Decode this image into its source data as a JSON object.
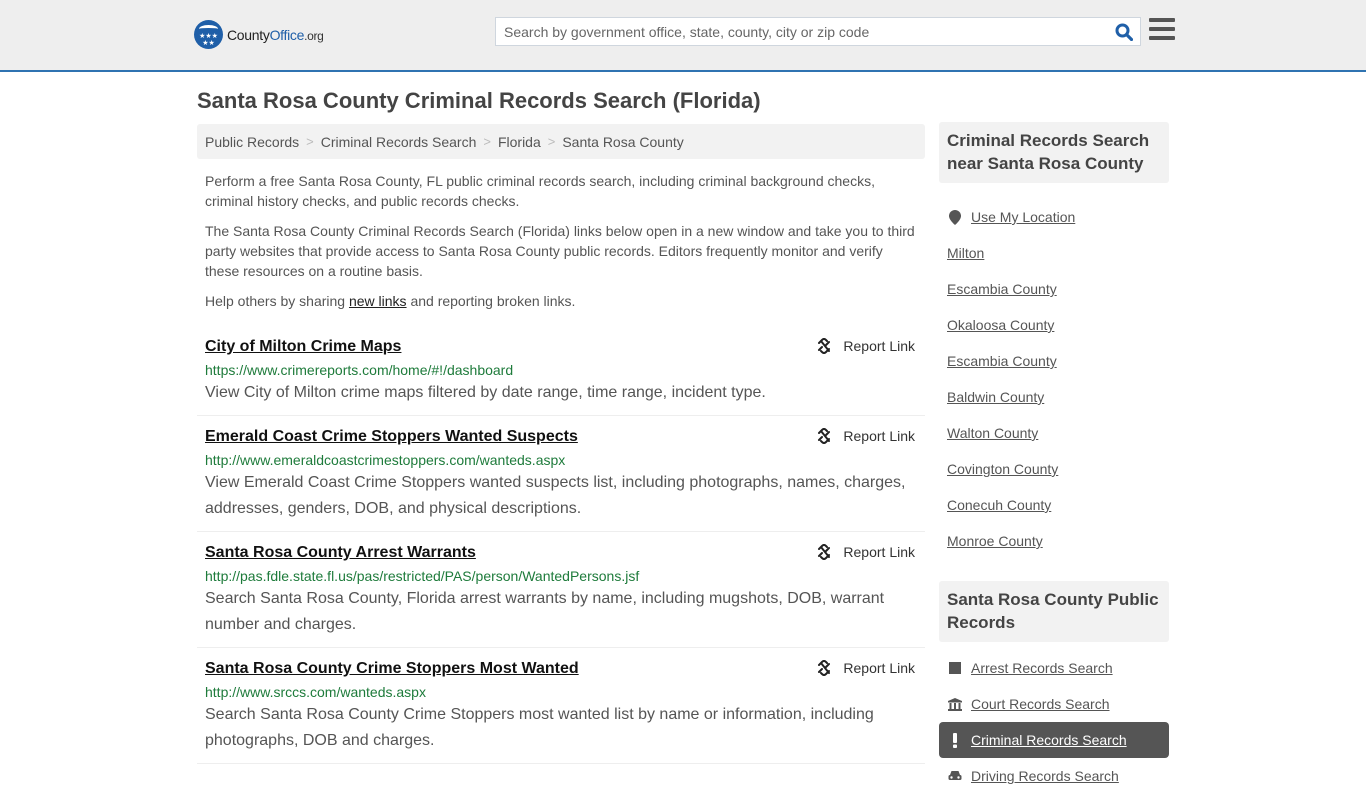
{
  "header": {
    "logo": {
      "brand_part1": "County",
      "brand_part2": "Office",
      "brand_tld": ".org",
      "brand_color": "#1f5fa8"
    },
    "search": {
      "placeholder": "Search by government office, state, county, city or zip code",
      "value": ""
    },
    "accent_color": "#2f73b1"
  },
  "page": {
    "title": "Santa Rosa County Criminal Records Search (Florida)"
  },
  "breadcrumb": [
    "Public Records",
    "Criminal Records Search",
    "Florida",
    "Santa Rosa County"
  ],
  "intro": {
    "p1": "Perform a free Santa Rosa County, FL public criminal records search, including criminal background checks, criminal history checks, and public records checks.",
    "p2": "The Santa Rosa County Criminal Records Search (Florida) links below open in a new window and take you to third party websites that provide access to Santa Rosa County public records. Editors frequently monitor and verify these resources on a routine basis.",
    "p3_before": "Help others by sharing ",
    "p3_link": "new links",
    "p3_after": " and reporting broken links."
  },
  "results": [
    {
      "title": "City of Milton Crime Maps",
      "url": "https://www.crimereports.com/home/#!/dashboard",
      "description": "View City of Milton crime maps filtered by date range, time range, incident type.",
      "report_label": "Report Link"
    },
    {
      "title": "Emerald Coast Crime Stoppers Wanted Suspects",
      "url": "http://www.emeraldcoastcrimestoppers.com/wanteds.aspx",
      "description": "View Emerald Coast Crime Stoppers wanted suspects list, including photographs, names, charges, addresses, genders, DOB, and physical descriptions.",
      "report_label": "Report Link"
    },
    {
      "title": "Santa Rosa County Arrest Warrants",
      "url": "http://pas.fdle.state.fl.us/pas/restricted/PAS/person/WantedPersons.jsf",
      "description": "Search Santa Rosa County, Florida arrest warrants by name, including mugshots, DOB, warrant number and charges.",
      "report_label": "Report Link"
    },
    {
      "title": "Santa Rosa County Crime Stoppers Most Wanted",
      "url": "http://www.srccs.com/wanteds.aspx",
      "description": "Search Santa Rosa County Crime Stoppers most wanted list by name or information, including photographs, DOB and charges.",
      "report_label": "Report Link"
    }
  ],
  "sidebar": {
    "nearby": {
      "heading": "Criminal Records Search near Santa Rosa County",
      "use_location": "Use My Location",
      "items": [
        "Milton",
        "Escambia County",
        "Okaloosa County",
        "Escambia County",
        "Baldwin County",
        "Walton County",
        "Covington County",
        "Conecuh County",
        "Monroe County"
      ]
    },
    "public_records": {
      "heading": "Santa Rosa County Public Records",
      "items": [
        {
          "label": "Arrest Records Search",
          "icon": "square-icon",
          "active": false
        },
        {
          "label": "Court Records Search",
          "icon": "courthouse-icon",
          "active": false
        },
        {
          "label": "Criminal Records Search",
          "icon": "exclamation-icon",
          "active": true
        },
        {
          "label": "Driving Records Search",
          "icon": "car-icon",
          "active": false
        }
      ]
    }
  }
}
